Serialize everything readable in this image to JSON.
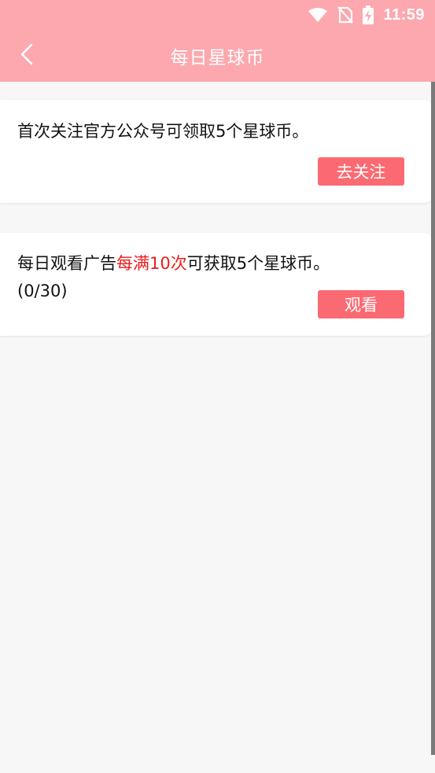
{
  "status_bar": {
    "time": "11:59",
    "icons": [
      "wifi-icon",
      "no-sim-icon",
      "battery-charging-icon"
    ]
  },
  "header": {
    "title": "每日星球币",
    "back_icon": "chevron-left-icon"
  },
  "colors": {
    "header_bg": "#fca8ae",
    "button_bg": "#fb6a72",
    "highlight": "#ee1b1b",
    "page_bg": "#f7f7f7"
  },
  "tasks": [
    {
      "text": "首次关注官方公众号可领取5个星球币。",
      "button_label": "去关注"
    },
    {
      "text_before": "每日观看广告",
      "text_highlight": "每满10次",
      "text_after": "可获取5个星球币。",
      "progress": "(0/30)",
      "button_label": "观看"
    }
  ]
}
